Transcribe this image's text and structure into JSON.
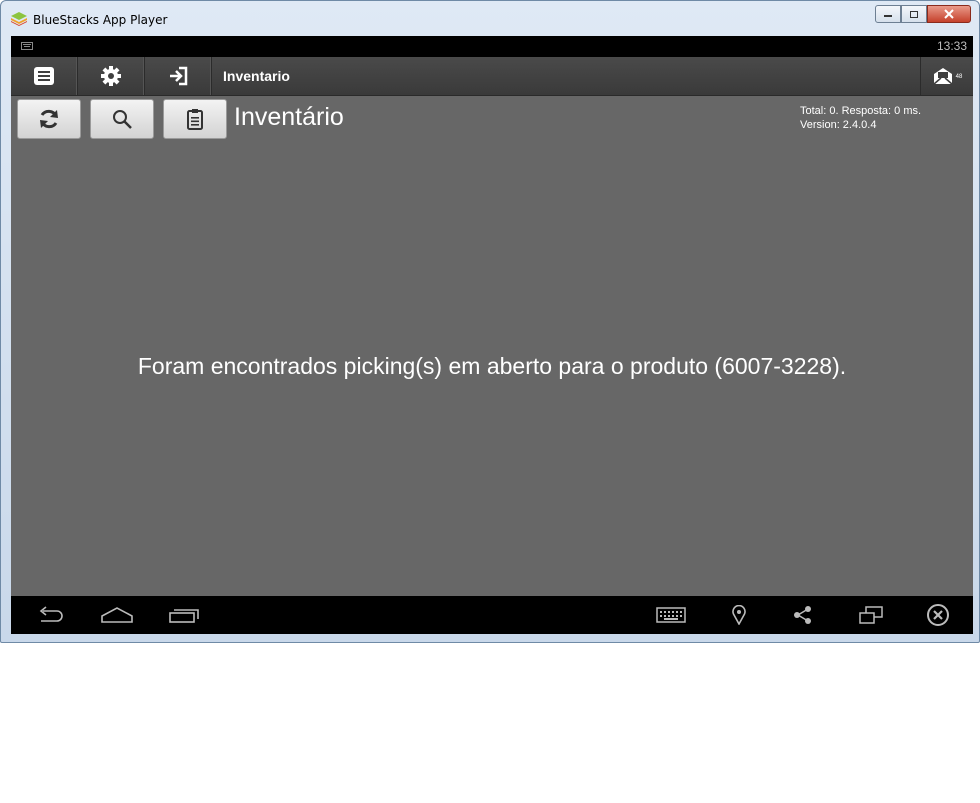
{
  "window": {
    "title": "BlueStacks App Player"
  },
  "statusbar": {
    "time": "13:33"
  },
  "actionbar": {
    "title": "Inventario",
    "mail_count": "48"
  },
  "icons": {
    "menu": "menu-icon",
    "settings": "gear-icon",
    "logout": "sign-in-icon",
    "mail": "mail-icon",
    "refresh": "refresh-icon",
    "search": "search-icon",
    "clipboard": "clipboard-icon",
    "back": "back-icon",
    "home": "home-icon",
    "recent": "recent-apps-icon",
    "keyboard": "keyboard-icon",
    "location": "location-icon",
    "share": "share-icon",
    "rotate": "rotate-icon",
    "close": "close-circle-icon"
  },
  "page": {
    "title": "Inventário",
    "stats_line1": "Total: 0. Resposta: 0 ms.",
    "stats_line2": "Version: 2.4.0.4",
    "message": "Foram encontrados picking(s) em aberto para o produto (6007-3228)."
  },
  "colors": {
    "content_bg": "#676767",
    "actionbar_bg": "#3a3a3a",
    "statusbar_bg": "#000000",
    "text": "#ffffff"
  }
}
